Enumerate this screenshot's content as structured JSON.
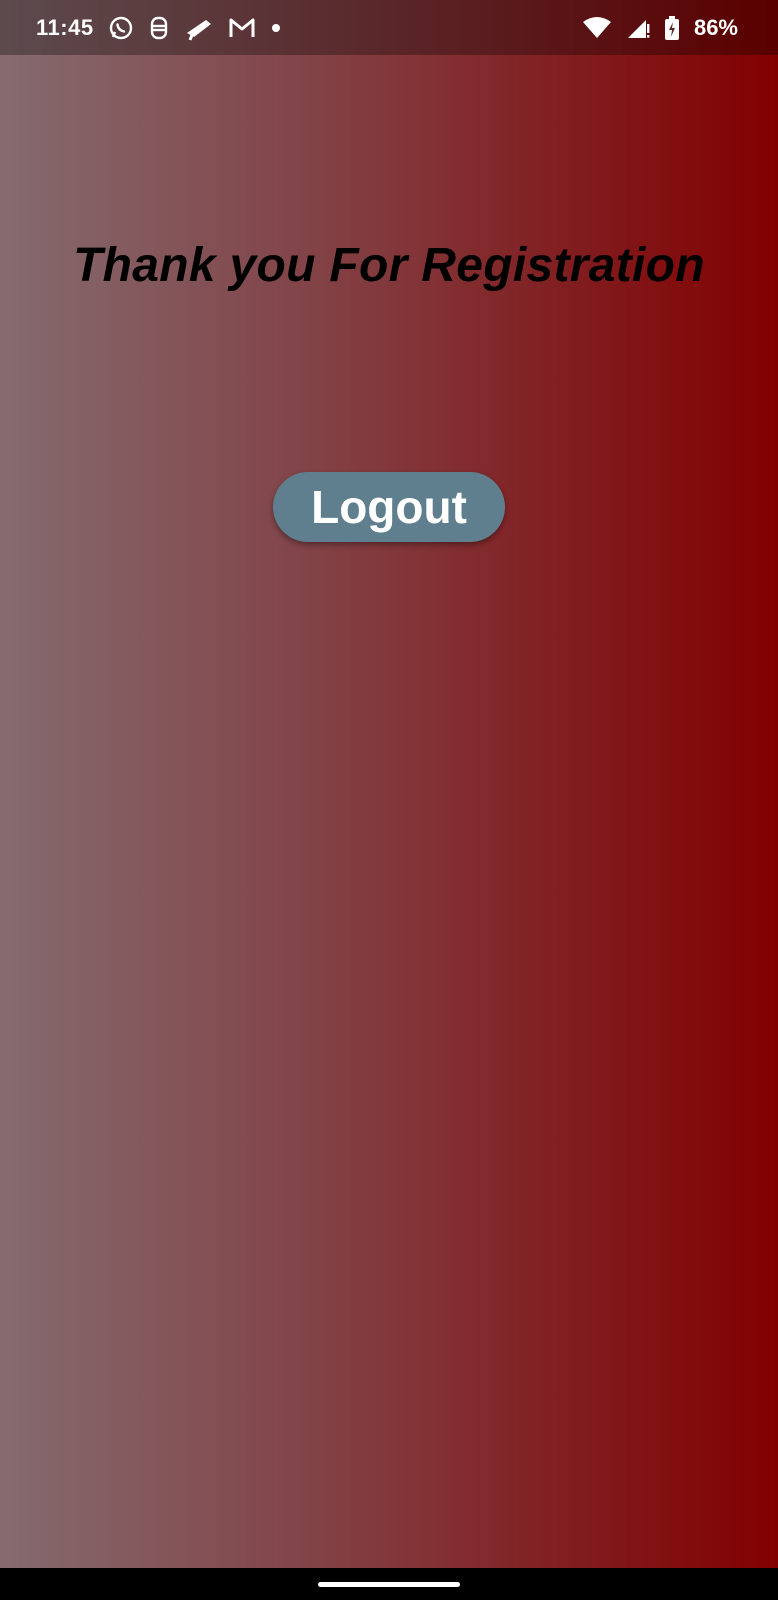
{
  "status_bar": {
    "time": "11:45",
    "notification_icons": [
      "whatsapp-icon",
      "app-icon",
      "tool-icon",
      "gmail-icon",
      "dot-icon"
    ],
    "battery_percent": "86%"
  },
  "main": {
    "headline": "Thank you For Registration",
    "logout_label": "Logout"
  },
  "colors": {
    "gradient_start": "#856b6f",
    "gradient_end": "#820000",
    "button_bg": "#5f7f8e",
    "headline_color": "#000000"
  }
}
